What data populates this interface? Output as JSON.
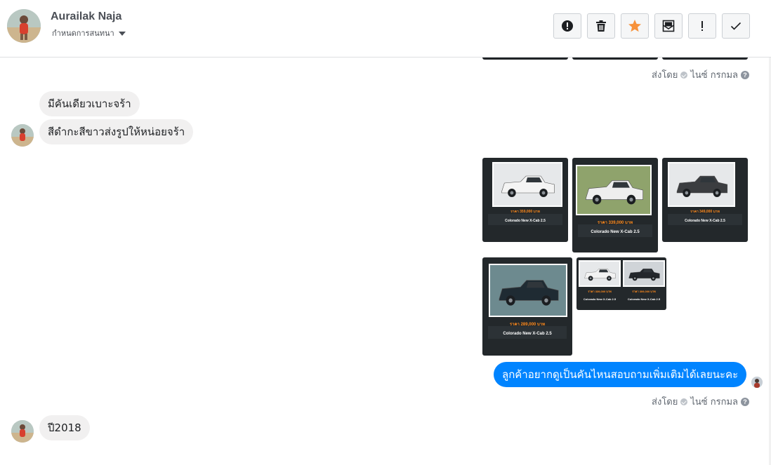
{
  "header": {
    "contact_name": "Aurailak Naja",
    "assign_label": "กำหนดการสนทนา",
    "toolbar": [
      {
        "name": "mark-spam-button",
        "icon": "alert-circle-icon"
      },
      {
        "name": "delete-button",
        "icon": "trash-icon"
      },
      {
        "name": "star-button",
        "icon": "star-icon"
      },
      {
        "name": "mark-unread-button",
        "icon": "envelope-icon"
      },
      {
        "name": "follow-up-button",
        "icon": "exclamation-icon"
      },
      {
        "name": "mark-done-button",
        "icon": "checkmark-icon"
      }
    ]
  },
  "colors": {
    "accent_blue": "#0084ff",
    "star_orange": "#f7923b",
    "bubble_gray": "#f1f0f0",
    "card_dark": "#23282b",
    "price_orange": "#ff8a1c"
  },
  "messages": {
    "sent_by_1": {
      "prefix": "ส่งโดย",
      "agent": "ไนซ์ กรกมล"
    },
    "incoming_1": "มีคันเดียวเบาะจร้า",
    "incoming_2": "สีดำกะสีขาวส่งรูปให้หน่อยจร้า",
    "outgoing_1": "ลูกค้าอยากดูเป็นคันไหนสอบถามเพิ่มเติมได้เลยนะคะ",
    "sent_by_2": {
      "prefix": "ส่งโดย",
      "agent": "ไนซ์ กรกมล"
    },
    "incoming_3": "ปี2018"
  },
  "car_cards": [
    {
      "price": "ราคา 359,000 บาท",
      "model": "Colorado New X-Cab 2.5",
      "photo_color": "#e6e8ea",
      "car_color": "#f4f4f4"
    },
    {
      "price": "ราคา 339,000 บาท",
      "model": "Colorado New X-Cab 2.5",
      "photo_color": "#8fa36c",
      "car_color": "#eeeeee"
    },
    {
      "price": "ราคา 349,000 บาท",
      "model": "Colorado New X-Cab 2.5",
      "photo_color": "#e6e8ea",
      "car_color": "#3b3d40"
    },
    {
      "price": "ราคา 289,000 บาท",
      "model": "Colorado New X-Cab 2.5",
      "photo_color": "#6d8a8f",
      "car_color": "#1f2b33"
    },
    {
      "price": "ราคา 339,000 บาท",
      "model": "Colorado New X-Cab 2.5",
      "photo_color": "#e6e8ea",
      "car_color": "#f2f2f2"
    },
    {
      "price": "ราคา 309,000 บาท",
      "model": "Colorado New X-Cab 2.5",
      "photo_color": "#d0d4d8",
      "car_color": "#23272c"
    }
  ]
}
